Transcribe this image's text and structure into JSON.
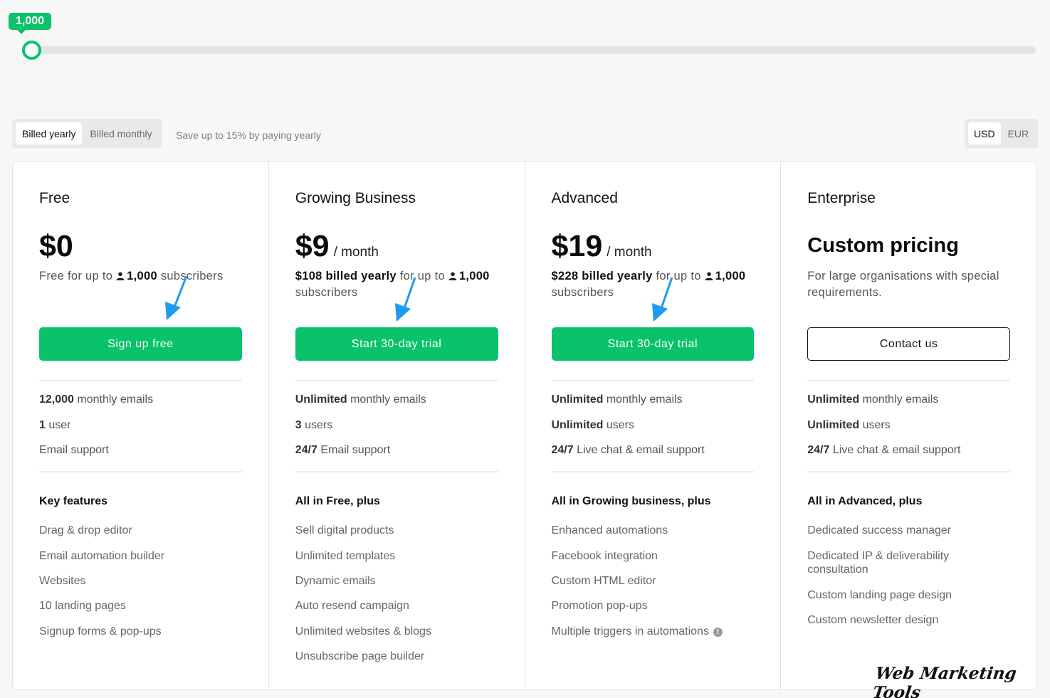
{
  "slider": {
    "value_label": "1,000",
    "level": 0.0
  },
  "billing": {
    "options": [
      "Billed yearly",
      "Billed monthly"
    ],
    "selected": "Billed yearly",
    "save_note": "Save up to 15% by paying yearly"
  },
  "currency": {
    "options": [
      "USD",
      "EUR"
    ],
    "selected": "USD"
  },
  "plans": [
    {
      "name": "Free",
      "price": "$0",
      "per": "",
      "desc_prefix": "Free for up to",
      "desc_count": "1,000",
      "desc_suffix": "subscribers",
      "cta": "Sign up free",
      "quotas": [
        {
          "bold": "12,000",
          "text": "monthly emails"
        },
        {
          "bold": "1",
          "text": "user"
        },
        {
          "bold": "",
          "text": "Email support"
        }
      ],
      "features_title": "Key features",
      "features": [
        "Drag & drop editor",
        "Email automation builder",
        "Websites",
        "10 landing pages",
        "Signup forms & pop-ups"
      ]
    },
    {
      "name": "Growing Business",
      "price": "$9",
      "per": "/ month",
      "desc_bold": "$108 billed yearly",
      "desc_prefix": "for up to",
      "desc_count": "1,000",
      "desc_suffix": "subscribers",
      "cta": "Start 30-day trial",
      "quotas": [
        {
          "bold": "Unlimited",
          "text": "monthly emails"
        },
        {
          "bold": "3",
          "text": "users"
        },
        {
          "bold": "24/7",
          "text": "Email support"
        }
      ],
      "features_title": "All in Free, plus",
      "features": [
        "Sell digital products",
        "Unlimited templates",
        "Dynamic emails",
        "Auto resend campaign",
        "Unlimited websites & blogs",
        "Unsubscribe page builder"
      ]
    },
    {
      "name": "Advanced",
      "price": "$19",
      "per": "/ month",
      "desc_bold": "$228 billed yearly",
      "desc_prefix": "for up to",
      "desc_count": "1,000",
      "desc_suffix": "subscribers",
      "cta": "Start 30-day trial",
      "quotas": [
        {
          "bold": "Unlimited",
          "text": "monthly emails"
        },
        {
          "bold": "Unlimited",
          "text": "users"
        },
        {
          "bold": "24/7",
          "text": "Live chat & email support"
        }
      ],
      "features_title": "All in Growing business, plus",
      "features": [
        "Enhanced automations",
        "Facebook integration",
        "Custom HTML editor",
        "Promotion pop-ups",
        "Multiple triggers in automations"
      ]
    },
    {
      "name": "Enterprise",
      "price": "Custom pricing",
      "desc_text": "For large organisations with special requirements.",
      "cta": "Contact us",
      "quotas": [
        {
          "bold": "Unlimited",
          "text": "monthly emails"
        },
        {
          "bold": "Unlimited",
          "text": "users"
        },
        {
          "bold": "24/7",
          "text": "Live chat & email support"
        }
      ],
      "features_title": "All in Advanced, plus",
      "features": [
        "Dedicated success manager",
        "Dedicated IP & deliverability consultation",
        "Custom landing page design",
        "Custom newsletter design"
      ]
    }
  ],
  "icons": {
    "user": "user-icon",
    "info": "info-icon",
    "arrow": "annotation-arrow-icon"
  },
  "colors": {
    "brand_green": "#09c269",
    "annotation_blue": "#1e9bf0"
  },
  "watermark": "Web Marketing Tools"
}
